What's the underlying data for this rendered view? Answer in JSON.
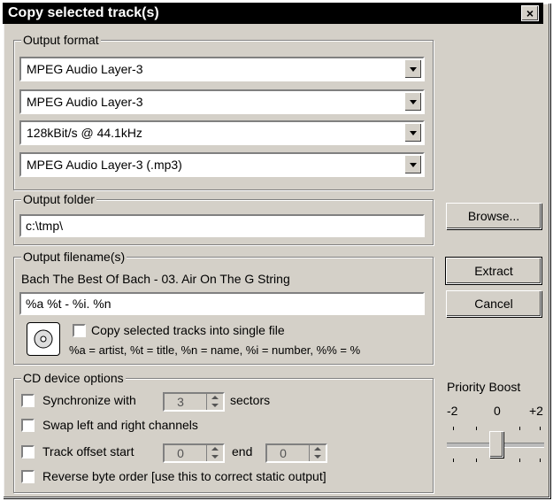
{
  "window": {
    "title": "Copy selected track(s)",
    "close_label": "×"
  },
  "output_format": {
    "legend": "Output format",
    "combos": [
      "MPEG Audio Layer-3",
      "MPEG Audio Layer-3",
      "128kBit/s @ 44.1kHz",
      "MPEG Audio Layer-3 (.mp3)"
    ]
  },
  "output_folder": {
    "legend": "Output folder",
    "value": "c:\\tmp\\"
  },
  "browse_button": "Browse...",
  "output_filenames": {
    "legend": "Output filename(s)",
    "preview": "Bach The Best Of Bach - 03. Air On The G String",
    "pattern": "%a %t - %i. %n",
    "single_file_label": "Copy selected tracks into single file",
    "legend_help": "%a = artist, %t = title, %n = name, %i = number, %% = %"
  },
  "buttons": {
    "extract": "Extract",
    "cancel": "Cancel"
  },
  "cd_device": {
    "legend": "CD device options",
    "sync_label": "Synchronize with",
    "sync_value": "3",
    "sectors_label": "sectors",
    "swap_label": "Swap left and right channels",
    "offset_start_label": "Track offset start",
    "offset_start_value": "0",
    "offset_end_label": "end",
    "offset_end_value": "0",
    "reverse_label": "Reverse byte order [use this to correct static output]"
  },
  "priority": {
    "label": "Priority Boost",
    "min": "-2",
    "mid": "0",
    "max": "+2",
    "value": 0
  }
}
